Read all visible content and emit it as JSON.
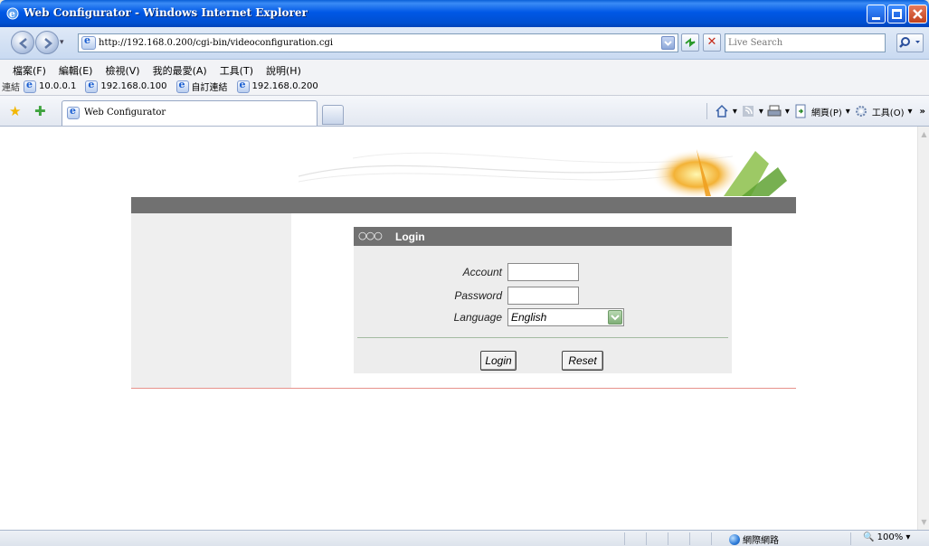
{
  "window": {
    "title": "Web Configurator - Windows Internet Explorer"
  },
  "address_bar": {
    "url": "http://192.168.0.200/cgi-bin/videoconfiguration.cgi",
    "search_placeholder": "Live Search"
  },
  "menu": {
    "items": [
      "檔案(F)",
      "編輯(E)",
      "檢視(V)",
      "我的最愛(A)",
      "工具(T)",
      "說明(H)"
    ]
  },
  "links_bar": {
    "label": "連結",
    "items": [
      "10.0.0.1",
      "192.168.0.100",
      "自訂連結",
      "192.168.0.200"
    ]
  },
  "tabs": {
    "active_label": "Web Configurator"
  },
  "command_bar": {
    "page_label": "網頁(P)",
    "tools_label": "工具(O)",
    "overflow": "»"
  },
  "login": {
    "title": "Login",
    "chain_glyph": "○○○",
    "account_label": "Account",
    "account_value": "",
    "password_label": "Password",
    "password_value": "",
    "language_label": "Language",
    "language_value": "English",
    "login_button": "Login",
    "reset_button": "Reset"
  },
  "status_bar": {
    "zone": "網際網路",
    "zoom": "100%"
  },
  "colors": {
    "title_bar": "#0058e6",
    "header_bar": "#717171",
    "left_panel": "#efefef",
    "login_bg": "#ededed",
    "accent_line": "#e7928c"
  }
}
